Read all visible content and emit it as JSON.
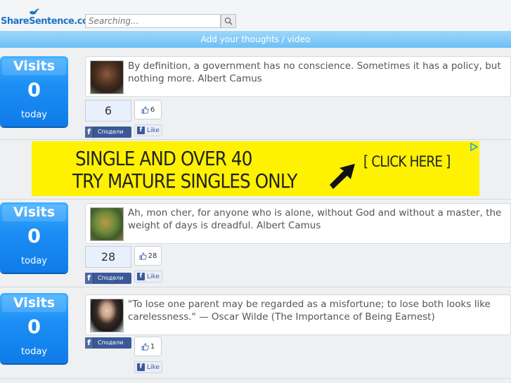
{
  "header": {
    "logo_text": "ShareSentence.com",
    "search_placeholder": "Searching...",
    "add_label": "Add your thoughts / video"
  },
  "ad": {
    "line1": "SINGLE AND OVER 40",
    "line2": "TRY MATURE SINGLES ONLY",
    "cta": "[ CLICK HERE ]"
  },
  "posts": [
    {
      "visits_title": "Visits",
      "visits_count": "0",
      "visits_footer": "today",
      "quote": "By definition, a government has no conscience. Sometimes it has a policy, but nothing more. Albert Camus",
      "count": "6",
      "thumbs": "6",
      "share_label": "Сподели",
      "like_label": "Like"
    },
    {
      "visits_title": "Visits",
      "visits_count": "0",
      "visits_footer": "today",
      "quote": "Ah, mon cher, for anyone who is alone, without God and without a master, the weight of days is dreadful. Albert Camus",
      "count": "28",
      "thumbs": "28",
      "share_label": "Сподели",
      "like_label": "Like"
    },
    {
      "visits_title": "Visits",
      "visits_count": "0",
      "visits_footer": "today",
      "quote": "\"To lose one parent may be regarded as a misfortune; to lose both looks like carelessness.\" — Oscar Wilde (The Importance of Being Earnest)",
      "thumbs": "1",
      "share_label": "Сподели",
      "like_label": "Like"
    }
  ]
}
